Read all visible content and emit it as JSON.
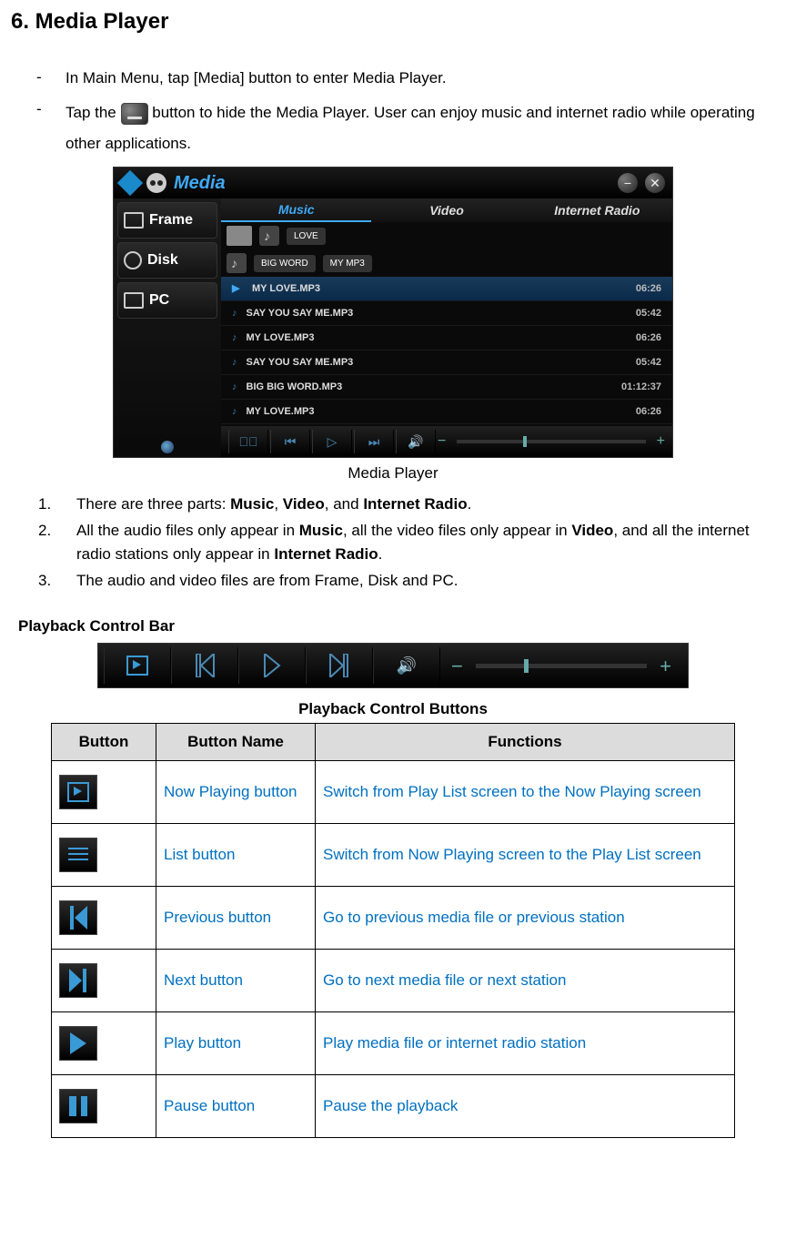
{
  "heading": "6. Media Player",
  "bullet1": "In Main Menu, tap [Media] button to enter Media Player.",
  "bullet2_prefix": "Tap the ",
  "bullet2_suffix": " button to hide the Media Player. User can enjoy music and internet radio while operating other applications.",
  "media_player": {
    "title": "Media",
    "sidebar": [
      "Frame",
      "Disk",
      "PC"
    ],
    "tabs": [
      "Music",
      "Video",
      "Internet Radio"
    ],
    "pills": [
      "LOVE",
      "BIG WORD",
      "MY MP3"
    ],
    "files": [
      {
        "name": "MY LOVE.MP3",
        "time": "06:26",
        "selected": true
      },
      {
        "name": "SAY YOU SAY ME.MP3",
        "time": "05:42",
        "selected": false
      },
      {
        "name": "MY LOVE.MP3",
        "time": "06:26",
        "selected": false
      },
      {
        "name": "SAY YOU SAY ME.MP3",
        "time": "05:42",
        "selected": false
      },
      {
        "name": "BIG BIG WORD.MP3",
        "time": "01:12:37",
        "selected": false
      },
      {
        "name": "MY LOVE.MP3",
        "time": "06:26",
        "selected": false
      }
    ]
  },
  "caption1": "Media Player",
  "numbered": [
    {
      "n": "1.",
      "html": "There are three parts: <b>Music</b>, <b>Video</b>, and <b>Internet Radio</b>."
    },
    {
      "n": "2.",
      "html": "All the audio files only appear in <b>Music</b>, all the video files only appear in <b>Video</b>, and all the internet radio stations only appear in <b>Internet Radio</b>."
    },
    {
      "n": "3.",
      "html": "The audio and video files are from Frame, Disk and PC."
    }
  ],
  "section_heading": "Playback Control Bar",
  "table_caption": "Playback Control Buttons",
  "table": {
    "headers": [
      "Button",
      "Button Name",
      "Functions"
    ],
    "rows": [
      {
        "icon": "nowplaying",
        "name": "Now Playing button",
        "func": "Switch from Play List screen to the Now Playing screen"
      },
      {
        "icon": "list",
        "name": "List button",
        "func": "Switch from Now Playing screen to the Play List screen"
      },
      {
        "icon": "prev",
        "name": "Previous button",
        "func": "Go to previous media file or previous station"
      },
      {
        "icon": "next",
        "name": "Next button",
        "func": "Go to next media file or next station"
      },
      {
        "icon": "play",
        "name": "Play button",
        "func": "Play media file or internet radio station"
      },
      {
        "icon": "pause",
        "name": "Pause button",
        "func": "Pause the playback"
      }
    ]
  },
  "vol_minus": "−",
  "vol_plus": "+"
}
